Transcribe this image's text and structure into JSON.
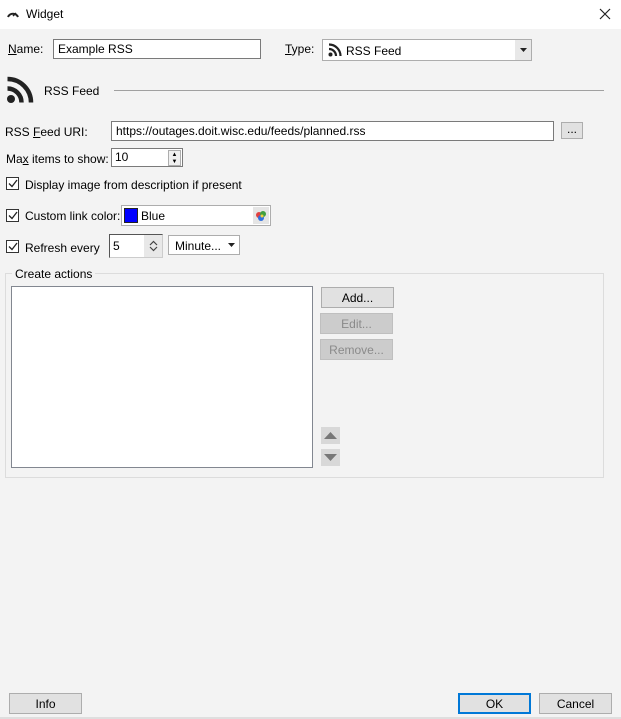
{
  "window": {
    "title": "Widget",
    "close_icon": "close-icon",
    "title_icon": "gauge-icon"
  },
  "header": {
    "name_label": "Name:",
    "name_value": "Example RSS",
    "type_label": "Type:",
    "type_value": "RSS Feed",
    "type_icon": "rss-icon"
  },
  "section": {
    "title": "RSS Feed",
    "icon": "rss-icon"
  },
  "form": {
    "uri_label": "RSS Feed URI:",
    "uri_value": "https://outages.doit.wisc.edu/feeds/planned.rss",
    "browse_label": "...",
    "max_items_label": "Max items to show:",
    "max_items_value": "10",
    "display_image_label": "Display image from description if present",
    "display_image_checked": true,
    "custom_color_label": "Custom link color:",
    "custom_color_checked": true,
    "color_name": "Blue",
    "color_hex": "#0000ff",
    "refresh_label": "Refresh every",
    "refresh_checked": true,
    "refresh_value": "5",
    "refresh_unit": "Minute..."
  },
  "actions": {
    "group_label": "Create actions",
    "items": [],
    "add_label": "Add...",
    "edit_label": "Edit...",
    "remove_label": "Remove..."
  },
  "footer": {
    "info_label": "Info",
    "ok_label": "OK",
    "cancel_label": "Cancel"
  },
  "colors": {
    "accent": "#0078d7",
    "background": "#f3f3f3"
  }
}
